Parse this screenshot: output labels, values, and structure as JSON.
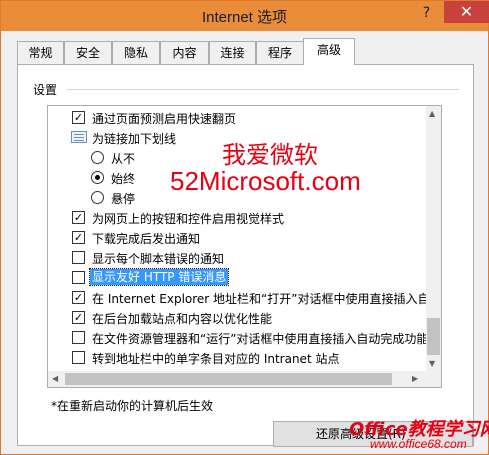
{
  "window": {
    "title": "Internet 选项",
    "help_glyph": "?",
    "close_glyph": "✕"
  },
  "tabs": [
    {
      "label": "常规",
      "active": false
    },
    {
      "label": "安全",
      "active": false
    },
    {
      "label": "隐私",
      "active": false
    },
    {
      "label": "内容",
      "active": false
    },
    {
      "label": "连接",
      "active": false
    },
    {
      "label": "程序",
      "active": false
    },
    {
      "label": "高级",
      "active": true
    }
  ],
  "settings": {
    "group_label": "设置",
    "items": [
      {
        "type": "checkbox",
        "checked": true,
        "label": "通过页面预测启用快速翻页"
      },
      {
        "type": "category",
        "label": "为链接加下划线"
      },
      {
        "type": "radio",
        "checked": false,
        "label": "从不"
      },
      {
        "type": "radio",
        "checked": true,
        "label": "始终"
      },
      {
        "type": "radio",
        "checked": false,
        "label": "悬停"
      },
      {
        "type": "checkbox",
        "checked": true,
        "label": "为网页上的按钮和控件启用视觉样式"
      },
      {
        "type": "checkbox",
        "checked": true,
        "label": "下载完成后发出通知"
      },
      {
        "type": "checkbox",
        "checked": false,
        "label": "显示每个脚本错误的通知"
      },
      {
        "type": "checkbox",
        "checked": false,
        "label": "显示友好 HTTP 错误消息",
        "selected": true
      },
      {
        "type": "checkbox",
        "checked": true,
        "label": "在 Internet Explorer 地址栏和“打开”对话框中使用直接插入自"
      },
      {
        "type": "checkbox",
        "checked": true,
        "label": "在后台加载站点和内容以优化性能"
      },
      {
        "type": "checkbox",
        "checked": false,
        "label": "在文件资源管理器和“运行”对话框中使用直接插入自动完成功能"
      },
      {
        "type": "checkbox",
        "checked": false,
        "label": "转到地址栏中的单字条目对应的 Intranet 站点"
      }
    ]
  },
  "overlay": {
    "line1": "我爱微软",
    "line2": "52Microsoft.com"
  },
  "note": "*在重新启动你的计算机后生效",
  "reset_button": "还原高级设置(R)",
  "watermark": {
    "brand": "Office教程学习网",
    "url": "www.office68.com"
  },
  "colors": {
    "titlebar": "#e98d3a",
    "close": "#c7423a",
    "selection": "#3399ff",
    "overlay_red": "#e60012"
  }
}
